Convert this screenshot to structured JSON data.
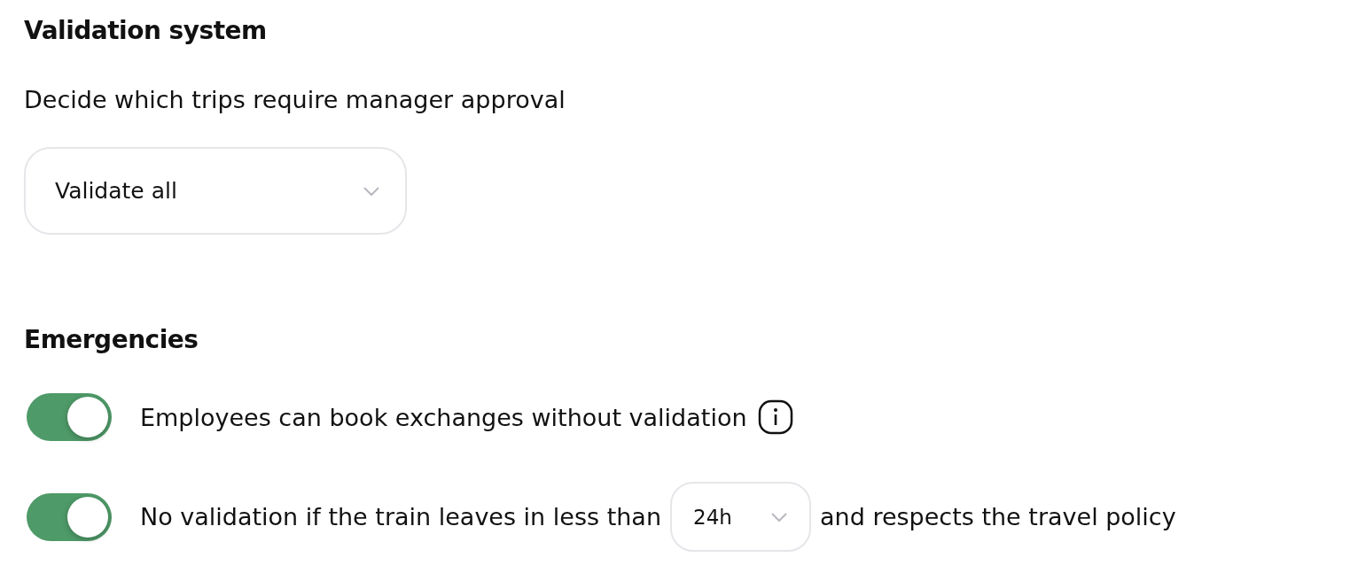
{
  "validation": {
    "title": "Validation system",
    "description": "Decide which trips require manager approval",
    "select": {
      "value": "Validate all"
    }
  },
  "emergencies": {
    "title": "Emergencies",
    "options": [
      {
        "kind": "text",
        "on": true,
        "text": "Employees can book exchanges without validation",
        "info": true
      },
      {
        "kind": "inline_select",
        "on": true,
        "before": "No validation if the train leaves in less than",
        "value": "24h",
        "after": "and respects the travel policy"
      }
    ]
  }
}
